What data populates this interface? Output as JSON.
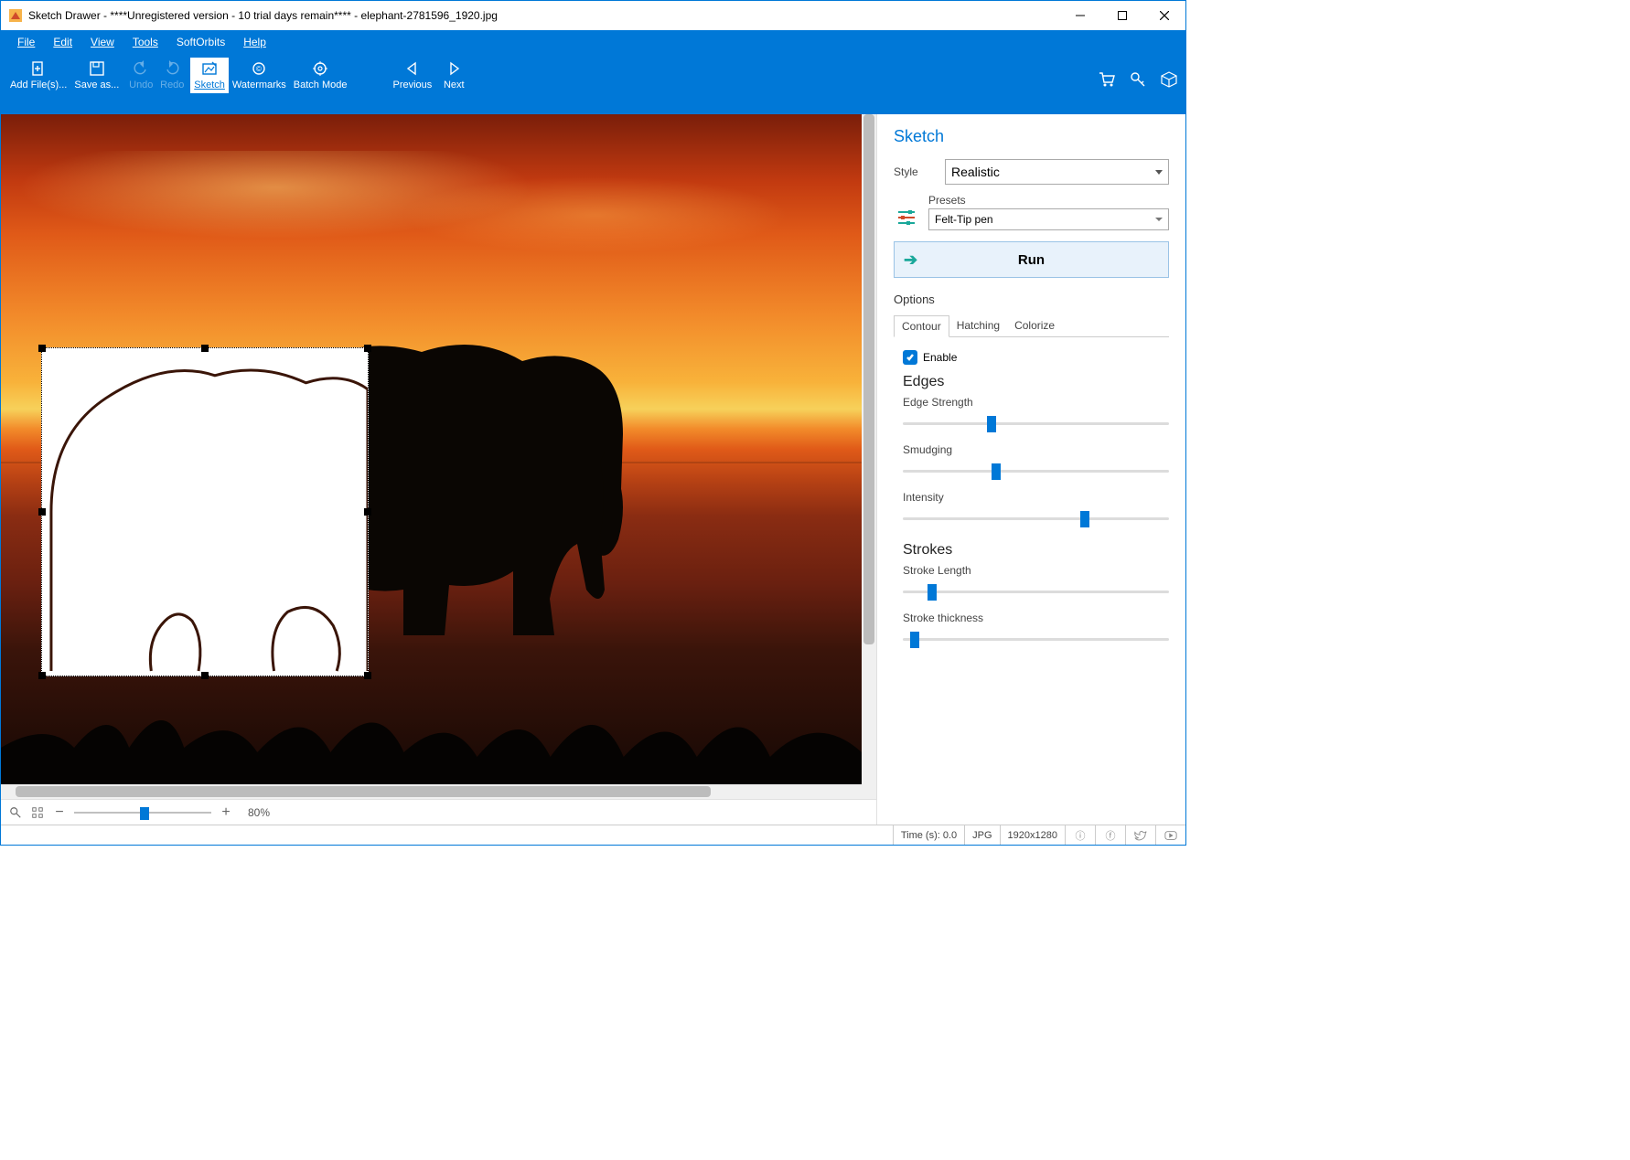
{
  "title": "Sketch Drawer - ****Unregistered version - 10 trial days remain**** - elephant-2781596_1920.jpg",
  "menu": {
    "file": "File",
    "edit": "Edit",
    "view": "View",
    "tools": "Tools",
    "softorbits": "SoftOrbits",
    "help": "Help"
  },
  "tools": {
    "addfiles": "Add File(s)...",
    "saveas": "Save as...",
    "undo": "Undo",
    "redo": "Redo",
    "sketch": "Sketch",
    "watermarks": "Watermarks",
    "batchmode": "Batch Mode",
    "previous": "Previous",
    "next": "Next"
  },
  "zoom": {
    "percent": "80%"
  },
  "panel": {
    "title": "Sketch",
    "style_lbl": "Style",
    "style_val": "Realistic",
    "presets_lbl": "Presets",
    "preset_val": "Felt-Tip pen",
    "run": "Run",
    "options": "Options",
    "tabs": {
      "contour": "Contour",
      "hatching": "Hatching",
      "colorize": "Colorize"
    },
    "enable": "Enable",
    "edges_h": "Edges",
    "edge_strength": "Edge Strength",
    "smudging": "Smudging",
    "intensity": "Intensity",
    "strokes_h": "Strokes",
    "stroke_length": "Stroke Length",
    "stroke_thickness": "Stroke thickness"
  },
  "sliders": {
    "edge_strength": 34,
    "smudging": 36,
    "intensity": 72,
    "stroke_length": 10,
    "stroke_thickness": 3
  },
  "status": {
    "time": "Time (s): 0.0",
    "format": "JPG",
    "dims": "1920x1280"
  }
}
